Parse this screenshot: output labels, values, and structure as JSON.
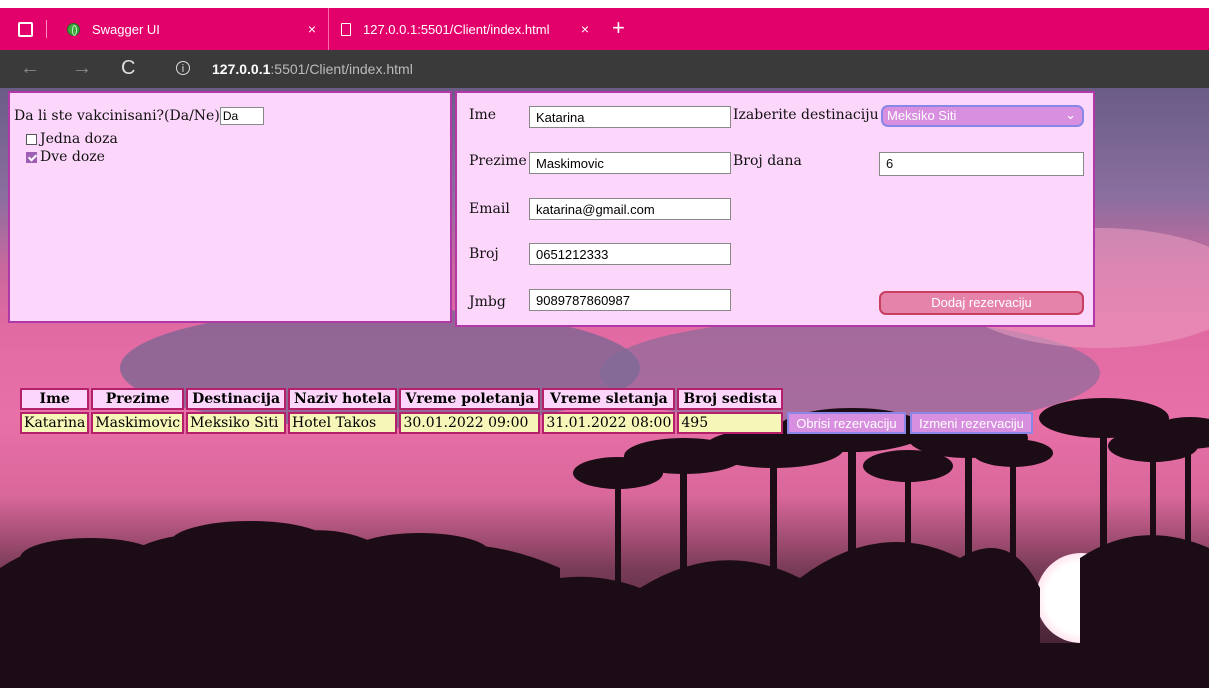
{
  "browser": {
    "tabs": [
      {
        "title": "Swagger UI",
        "close": "×"
      },
      {
        "title": "127.0.0.1:5501/Client/index.html",
        "close": "×"
      }
    ],
    "new_tab": "+",
    "url_host": "127.0.0.1",
    "url_rest": ":5501/Client/index.html",
    "back": "←",
    "forward": "→",
    "reload": "C",
    "info": "i"
  },
  "vaccine": {
    "question": "Da li ste vakcinisani?(Da/Ne)",
    "answer": "Da",
    "options": [
      {
        "label": "Jedna doza",
        "checked": false
      },
      {
        "label": "Dve doze",
        "checked": true
      }
    ]
  },
  "form": {
    "ime_label": "Ime",
    "ime_value": "Katarina",
    "prezime_label": "Prezime",
    "prezime_value": "Maskimovic",
    "email_label": "Email",
    "email_value": "katarina@gmail.com",
    "broj_label": "Broj",
    "broj_value": "0651212333",
    "jmbg_label": "Jmbg",
    "jmbg_value": "9089787860987",
    "destination_label": "Izaberite destinaciju",
    "destination_value": "Meksiko Siti",
    "days_label": "Broj dana",
    "days_value": "6",
    "add_button": "Dodaj rezervaciju"
  },
  "table": {
    "headers": [
      "Ime",
      "Prezime",
      "Destinacija",
      "Naziv hotela",
      "Vreme poletanja",
      "Vreme sletanja",
      "Broj sedista"
    ],
    "rows": [
      [
        "Katarina",
        "Maskimovic",
        "Meksiko Siti",
        "Hotel Takos",
        "30.01.2022 09:00",
        "31.01.2022 08:00",
        "495"
      ]
    ],
    "delete_button": "Obrisi rezervaciju",
    "edit_button": "Izmeni rezervaciju"
  }
}
